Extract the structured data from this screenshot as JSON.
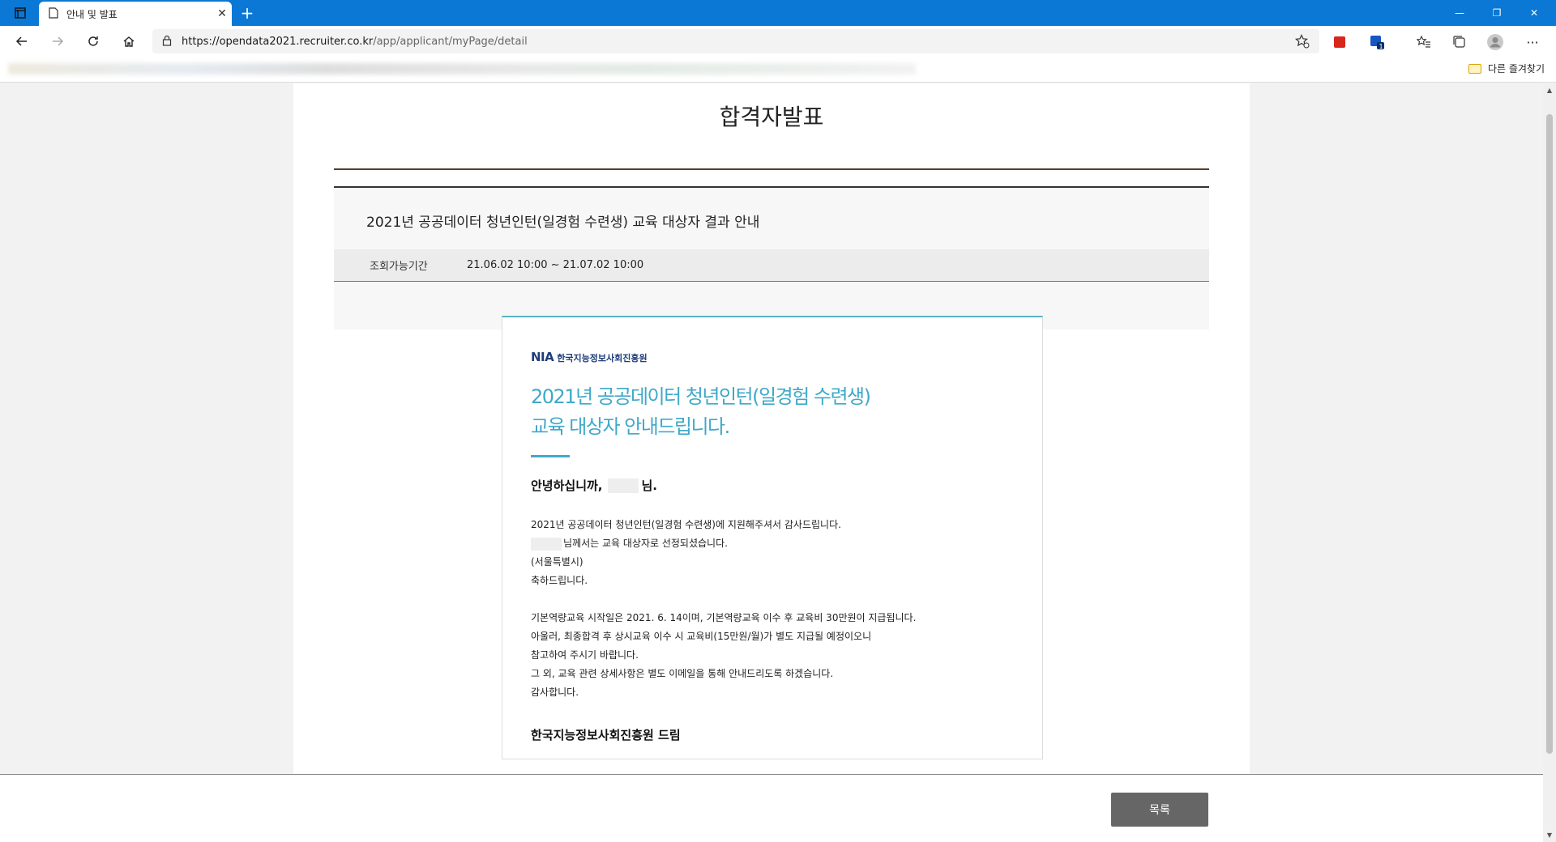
{
  "browser": {
    "tab_title": "안내 및 발표",
    "url_host": "https://opendata2021.recruiter.co.kr",
    "url_path": "/app/applicant/myPage/detail",
    "other_favorites": "다른 즐겨찾기",
    "accent_color": "#0a78d4"
  },
  "page": {
    "title": "합격자발표",
    "notice_title": "2021년 공공데이터 청년인턴(일경험 수련생) 교육 대상자 결과 안내",
    "period_label": "조회가능기간",
    "period_value": "21.06.02 10:00 ~ 21.07.02 10:00",
    "list_button": "목록"
  },
  "mail": {
    "logo_mark": "NIA",
    "logo_org": "한국지능정보사회진흥원",
    "headline_1": "2021년 공공데이터 청년인턴(일경험 수련생)",
    "headline_2": "교육 대상자 안내드립니다.",
    "greeting_prefix": "안녕하십니까,",
    "greeting_suffix": "님.",
    "line1": "2021년 공공데이터 청년인턴(일경험 수련생)에 지원해주셔서 감사드립니다.",
    "line2_suffix": "님께서는 교육 대상자로 선정되셨습니다.",
    "line3": "(서울특별시)",
    "line4": "축하드립니다.",
    "line5": "기본역량교육 시작일은 2021. 6. 14이며, 기본역량교육 이수 후 교육비 30만원이 지급됩니다.",
    "line6": "아울러, 최종합격 후 상시교육 이수 시 교육비(15만원/월)가 별도 지급될 예정이오니",
    "line7": "참고하여 주시기 바랍니다.",
    "line8": "그 외, 교육 관련 상세사항은 별도 이메일을 통해 안내드리도록 하겠습니다.",
    "line9": "감사합니다.",
    "signature": "한국지능정보사회진흥원 드림",
    "accent_color": "#3fa9c9"
  }
}
